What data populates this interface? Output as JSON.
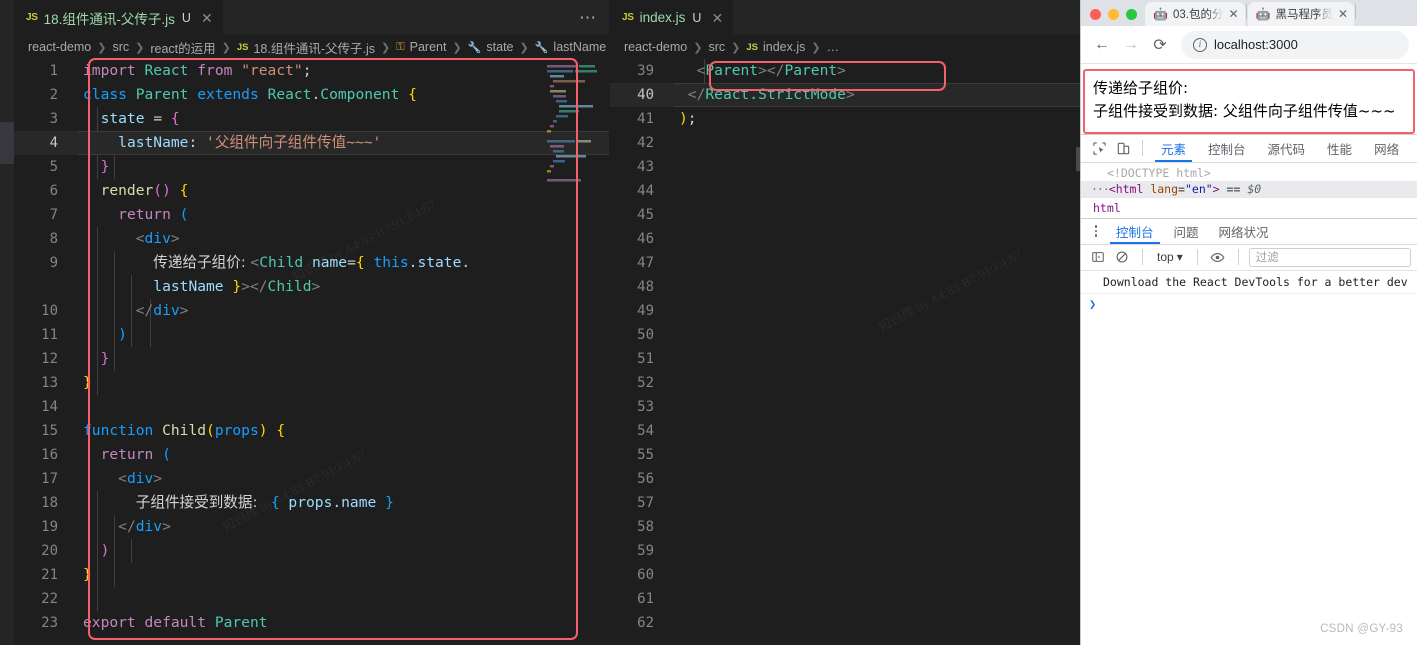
{
  "vscode": {
    "left_editor": {
      "tab": {
        "icon": "js-file-icon",
        "filename": "18.组件通讯-父传子.js",
        "dirty": "U",
        "close": "✕"
      },
      "overflow_menu": "⋯",
      "breadcrumb": [
        "react-demo",
        "src",
        "react的运用",
        "18.组件通讯-父传子.js",
        "Parent",
        "state",
        "lastName"
      ],
      "lines": [
        {
          "n": "1",
          "active": false
        },
        {
          "n": "2",
          "active": false
        },
        {
          "n": "3",
          "active": false
        },
        {
          "n": "4",
          "active": true
        },
        {
          "n": "5",
          "active": false
        },
        {
          "n": "6",
          "active": false
        },
        {
          "n": "7",
          "active": false
        },
        {
          "n": "8",
          "active": false
        },
        {
          "n": "9",
          "active": false
        },
        {
          "n": "",
          "active": false
        },
        {
          "n": "10",
          "active": false
        },
        {
          "n": "11",
          "active": false
        },
        {
          "n": "12",
          "active": false
        },
        {
          "n": "13",
          "active": false
        },
        {
          "n": "14",
          "active": false
        },
        {
          "n": "15",
          "active": false
        },
        {
          "n": "16",
          "active": false
        },
        {
          "n": "17",
          "active": false
        },
        {
          "n": "18",
          "active": false
        },
        {
          "n": "19",
          "active": false
        },
        {
          "n": "20",
          "active": false
        },
        {
          "n": "21",
          "active": false
        },
        {
          "n": "22",
          "active": false
        },
        {
          "n": "23",
          "active": false
        }
      ],
      "code_text": [
        "import React from \"react\";",
        "class Parent extends React.Component {",
        "  state = {",
        "    lastName: '父组件向子组件传值~~~'",
        "  }",
        "  render() {",
        "    return (",
        "      <div>",
        "        传递给子组价: <Child name={ this.state.",
        "        lastName }></Child>",
        "      </div>",
        "    )",
        "  }",
        "}",
        "",
        "function Child(props) {",
        "  return (",
        "    <div>",
        "      子组件接受到数据:  { props.name }",
        "    </div>",
        "  )",
        "}",
        "",
        "export default Parent"
      ]
    },
    "right_editor": {
      "tab": {
        "icon": "js-file-icon",
        "filename": "index.js",
        "dirty": "U",
        "close": "✕"
      },
      "breadcrumb": [
        "react-demo",
        "src",
        "index.js",
        "…"
      ],
      "lines": [
        {
          "n": "39",
          "active": false,
          "text": "  <Parent></Parent>"
        },
        {
          "n": "40",
          "active": true,
          "text": " </React.StrictMode>"
        },
        {
          "n": "41",
          "active": false,
          "text": ");"
        },
        {
          "n": "42",
          "active": false,
          "text": ""
        },
        {
          "n": "43",
          "active": false,
          "text": ""
        },
        {
          "n": "44",
          "active": false,
          "text": ""
        },
        {
          "n": "45",
          "active": false,
          "text": ""
        },
        {
          "n": "46",
          "active": false,
          "text": ""
        },
        {
          "n": "47",
          "active": false,
          "text": ""
        },
        {
          "n": "48",
          "active": false,
          "text": ""
        },
        {
          "n": "49",
          "active": false,
          "text": ""
        },
        {
          "n": "50",
          "active": false,
          "text": ""
        },
        {
          "n": "51",
          "active": false,
          "text": ""
        },
        {
          "n": "52",
          "active": false,
          "text": ""
        },
        {
          "n": "53",
          "active": false,
          "text": ""
        },
        {
          "n": "54",
          "active": false,
          "text": ""
        },
        {
          "n": "55",
          "active": false,
          "text": ""
        },
        {
          "n": "56",
          "active": false,
          "text": ""
        },
        {
          "n": "57",
          "active": false,
          "text": ""
        },
        {
          "n": "58",
          "active": false,
          "text": ""
        },
        {
          "n": "59",
          "active": false,
          "text": ""
        },
        {
          "n": "60",
          "active": false,
          "text": ""
        },
        {
          "n": "61",
          "active": false,
          "text": ""
        },
        {
          "n": "62",
          "active": false,
          "text": ""
        }
      ]
    }
  },
  "browser": {
    "window_controls": {
      "close": "close",
      "minimize": "minimize",
      "maximize": "maximize"
    },
    "tabs": [
      {
        "title": "03.包的分",
        "favicon": "robot-icon",
        "close": "✕"
      },
      {
        "title": "黑马程序员",
        "favicon": "robot-icon",
        "close": "✕"
      }
    ],
    "nav": {
      "back": "←",
      "forward": "→",
      "reload": "⟳"
    },
    "url": "localhost:3000",
    "page_content": [
      "传递给子组价:",
      "子组件接受到数据:  父组件向子组件传值~~~"
    ]
  },
  "devtools": {
    "toolbar_icons": [
      "inspect-element-icon",
      "device-toolbar-icon"
    ],
    "panels": [
      {
        "label": "元素",
        "selected": true
      },
      {
        "label": "控制台",
        "selected": false
      },
      {
        "label": "源代码",
        "selected": false
      },
      {
        "label": "性能",
        "selected": false
      },
      {
        "label": "网络",
        "selected": false
      }
    ],
    "dom": {
      "doctype": "<!DOCTYPE html>",
      "html_open": "<html lang=\"en\">",
      "html_tag": "html",
      "html_attr_name": "lang",
      "html_attr_value": "\"en\"",
      "selection_marker": "== $0",
      "dots": "···"
    },
    "crumb": "html",
    "drawer_tabs": [
      {
        "label": "控制台",
        "selected": true
      },
      {
        "label": "问题",
        "selected": false
      },
      {
        "label": "网络状况",
        "selected": false
      }
    ],
    "console_bar": {
      "sidebar_toggle": "console-sidebar-icon",
      "clear": "clear-console-icon",
      "context": "top",
      "context_caret": "▾",
      "eye": "live-expression-icon",
      "filter_placeholder": "过滤"
    },
    "console_messages": [
      "Download the React DevTools for a better dev"
    ],
    "prompt": "❯"
  },
  "watermark": "CSDN @GY-93",
  "colors": {
    "accent_red": "#f4606c",
    "vscode_bg": "#1e1e1e",
    "vscode_tabbar": "#252526",
    "devtools_blue": "#1a73e8"
  }
}
